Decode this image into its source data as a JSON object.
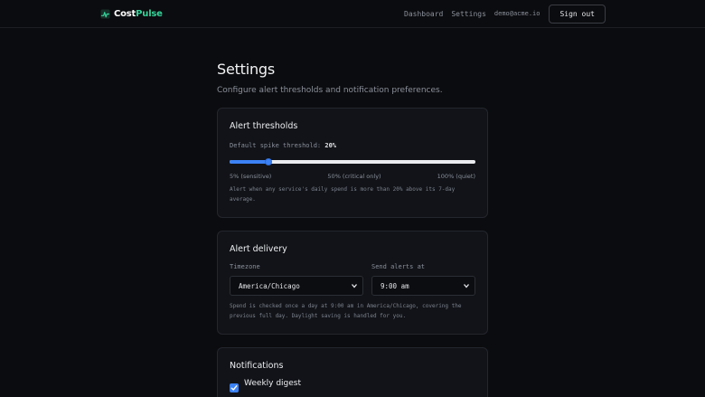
{
  "brand": {
    "part1": "Cost",
    "part2": "Pulse"
  },
  "nav": {
    "dashboard": "Dashboard",
    "settings": "Settings",
    "email": "demo@acme.io",
    "signout": "Sign out"
  },
  "page": {
    "title": "Settings",
    "subtitle": "Configure alert thresholds and notification preferences."
  },
  "thresholds": {
    "title": "Alert thresholds",
    "label": "Default spike threshold:",
    "value_text": "20%",
    "value": 20,
    "min": 5,
    "max": 100,
    "tick_min": "5% (sensitive)",
    "tick_mid": "50% (critical only)",
    "tick_max": "100% (quiet)",
    "help": "Alert when any service's daily spend is more than 20% above its 7-day average."
  },
  "delivery": {
    "title": "Alert delivery",
    "timezone_label": "Timezone",
    "timezone_value": "America/Chicago",
    "send_label": "Send alerts at",
    "send_value": "9:00 am",
    "help": "Spend is checked once a day at 9:00 am in America/Chicago, covering the previous full day. Daylight saving is handled for you."
  },
  "notifications": {
    "title": "Notifications",
    "weekly_digest": "Weekly digest",
    "weekly_digest_checked": true
  },
  "colors": {
    "accent": "#3b82f6",
    "brand_green": "#34d399",
    "background": "#0b0c0f",
    "card": "#111318"
  }
}
